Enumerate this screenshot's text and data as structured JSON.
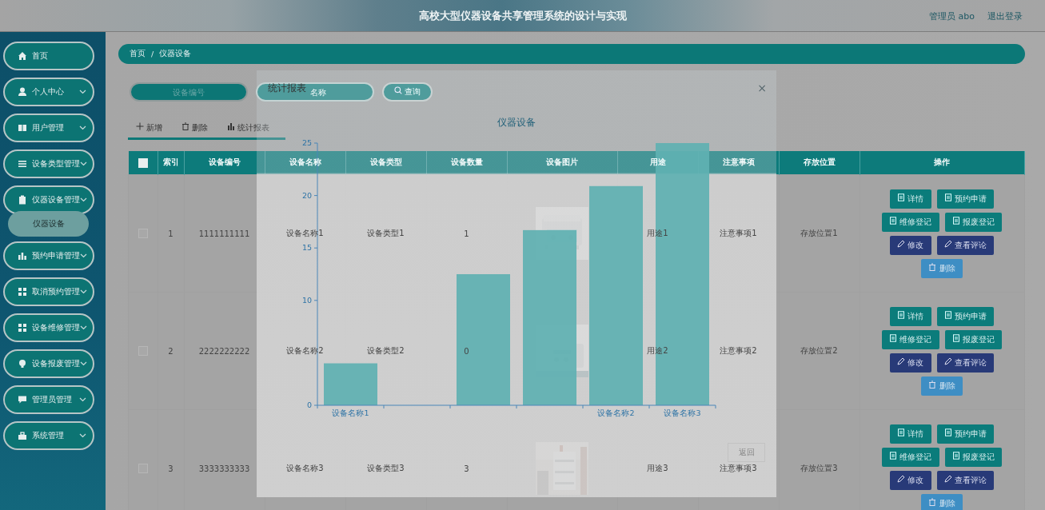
{
  "header": {
    "title": "高校大型仪器设备共享管理系统的设计与实现",
    "user": "管理员 abo",
    "logout": "退出登录"
  },
  "sidebar": {
    "items": [
      {
        "label": "首页",
        "expandable": false
      },
      {
        "label": "个人中心",
        "expandable": true
      },
      {
        "label": "用户管理",
        "expandable": true
      },
      {
        "label": "设备类型管理",
        "expandable": true
      },
      {
        "label": "仪器设备管理",
        "expandable": true,
        "children": [
          {
            "label": "仪器设备",
            "selected": true
          }
        ]
      },
      {
        "label": "预约申请管理",
        "expandable": true
      },
      {
        "label": "取消预约管理",
        "expandable": true
      },
      {
        "label": "设备维修管理",
        "expandable": true
      },
      {
        "label": "设备报废管理",
        "expandable": true
      },
      {
        "label": "管理员管理",
        "expandable": true
      },
      {
        "label": "系统管理",
        "expandable": true
      }
    ]
  },
  "breadcrumb": {
    "items": [
      "首页",
      "仪器设备"
    ],
    "separator": "/"
  },
  "search": {
    "fields": [
      {
        "placeholder": "设备编号"
      },
      {
        "placeholder": "名称"
      }
    ],
    "button": "查询"
  },
  "toolbar": [
    {
      "label": "新增",
      "kind": "add"
    },
    {
      "label": "删除",
      "kind": "delete"
    },
    {
      "label": "统计报表",
      "kind": "chart"
    }
  ],
  "table": {
    "all_checked": false,
    "columns": [
      "索引",
      "设备编号",
      "设备名称",
      "设备类型",
      "设备数量",
      "设备图片",
      "用途",
      "注意事项",
      "存放位置",
      "操作"
    ],
    "rows": [
      {
        "checked": false,
        "cells": [
          "1",
          "1111111111",
          "设备名称1",
          "设备类型1",
          "1",
          {
            "kind": "picture"
          },
          "用途1",
          "注意事项1",
          "存放位置1"
        ],
        "actions": [
          {
            "label": "详情",
            "kind": "info"
          },
          {
            "label": "预约申请",
            "kind": "info"
          },
          {
            "label": "维修登记",
            "kind": "info"
          },
          {
            "label": "报废登记",
            "kind": "info"
          },
          {
            "label": "修改",
            "kind": "edit"
          },
          {
            "label": "查看评论",
            "kind": "edit"
          },
          {
            "label": "删除",
            "kind": "danger"
          }
        ]
      },
      {
        "checked": false,
        "cells": [
          "2",
          "2222222222",
          "设备名称2",
          "设备类型2",
          "0",
          {
            "kind": "picture"
          },
          "用途2",
          "注意事项2",
          "存放位置2"
        ],
        "actions": [
          {
            "label": "详情",
            "kind": "info"
          },
          {
            "label": "预约申请",
            "kind": "info"
          },
          {
            "label": "维修登记",
            "kind": "info"
          },
          {
            "label": "报废登记",
            "kind": "info"
          },
          {
            "label": "修改",
            "kind": "edit"
          },
          {
            "label": "查看评论",
            "kind": "edit"
          },
          {
            "label": "删除",
            "kind": "danger"
          }
        ]
      },
      {
        "checked": false,
        "cells": [
          "3",
          "3333333333",
          "设备名称3",
          "设备类型3",
          "3",
          {
            "kind": "picture"
          },
          "用途3",
          "注意事项3",
          "存放位置3"
        ],
        "actions": [
          {
            "label": "详情",
            "kind": "info"
          },
          {
            "label": "预约申请",
            "kind": "info"
          },
          {
            "label": "维修登记",
            "kind": "info"
          },
          {
            "label": "报废登记",
            "kind": "info"
          },
          {
            "label": "修改",
            "kind": "edit"
          },
          {
            "label": "查看评论",
            "kind": "edit"
          },
          {
            "label": "删除",
            "kind": "danger"
          }
        ]
      }
    ]
  },
  "dialog": {
    "title": "统计报表",
    "close": "×",
    "back": "返回",
    "chart_data": {
      "type": "bar",
      "title": "仪器设备",
      "categories": [
        "设备名称1",
        null,
        null,
        null,
        "设备名称2",
        "设备名称3"
      ],
      "values": [
        4,
        null,
        12.5,
        16.7,
        20.9,
        25
      ],
      "ylim": [
        0,
        25
      ],
      "yticks": [
        0,
        10,
        15,
        20,
        25
      ]
    }
  }
}
